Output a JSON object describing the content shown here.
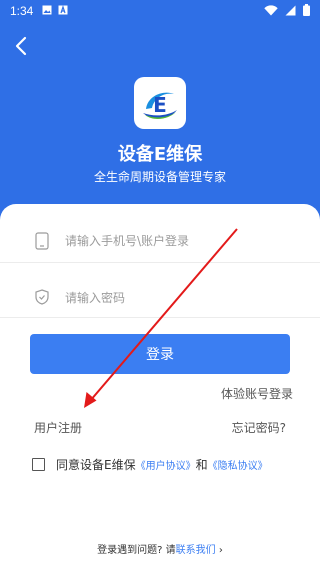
{
  "status_bar": {
    "time": "1:34",
    "left_icons": [
      "image-icon",
      "text-a-icon"
    ],
    "right_icons": [
      "wifi-icon",
      "signal-icon",
      "battery-icon"
    ]
  },
  "header": {
    "back_icon": "back-chevron-icon",
    "logo_icon": "device-e-logo-icon",
    "app_name": "设备E维保",
    "slogan": "全生命周期设备管理专家"
  },
  "login_form": {
    "account_placeholder": "请输入手机号\\账户登录",
    "account_icon": "phone-icon",
    "password_placeholder": "请输入密码",
    "password_icon": "shield-icon",
    "login_label": "登录",
    "trial_account_label": "体验账号登录",
    "register_label": "用户注册",
    "forgot_password_label": "忘记密码?"
  },
  "agreement": {
    "prefix": "同意设备E维保",
    "user_agreement": "《用户协议》",
    "conjunction": "和",
    "privacy_policy": "《隐私协议》"
  },
  "footer": {
    "help_prefix": "登录遇到问题? 请",
    "contact_label": "联系我们",
    "chevron": "›"
  },
  "colors": {
    "header_background": "#2f6fe6",
    "primary_button": "#3b7ef2",
    "link": "#3b7ef2",
    "annotation_arrow": "#e31a1a"
  }
}
